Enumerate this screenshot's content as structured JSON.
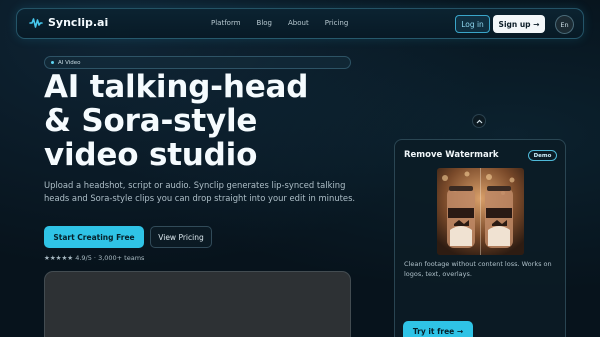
{
  "nav": {
    "brand": "Synclip.ai",
    "links": [
      "Platform",
      "Blog",
      "About",
      "Pricing"
    ],
    "login": "Log in",
    "signup": "Sign up →",
    "lang": "En"
  },
  "hero": {
    "tag": "AI Video",
    "headline_lines": [
      "AI talking-head",
      "& Sora-style",
      "video studio"
    ],
    "subtitle": "Upload a headshot, script or audio. Synclip generates lip-synced talking heads and Sora-style clips you can drop straight into your edit in minutes.",
    "cta_primary": "Start Creating Free",
    "cta_secondary": "View Pricing",
    "rating": "★★★★★ 4.9/5 · 3,000+ teams"
  },
  "card": {
    "title": "Remove Watermark",
    "badge": "Demo",
    "description": "Clean footage without content loss. Works on logos, text, overlays.",
    "cta": "Try it free →"
  },
  "colors": {
    "accent": "#2fc3e6",
    "background": "#07131c"
  },
  "icons": {
    "brand": "waveform-icon",
    "scroll": "chevron-up-icon"
  }
}
